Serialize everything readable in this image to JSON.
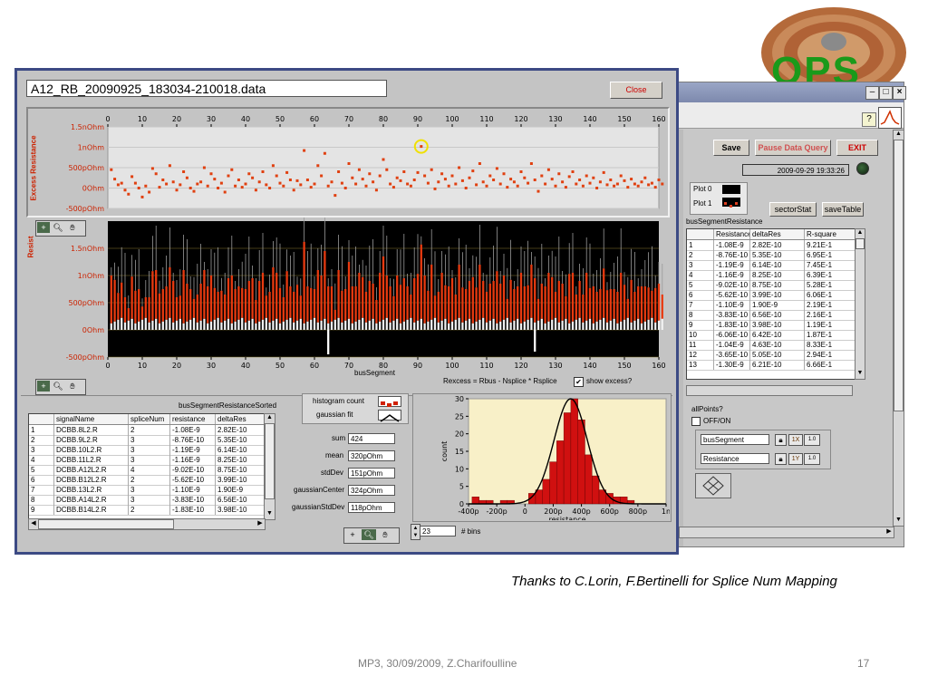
{
  "slide": {
    "caption": "Thanks to C.Lorin, F.Bertinelli for Splice Num Mapping",
    "footer": "MP3, 30/09/2009, Z.Charifoulline",
    "page_number": "17",
    "logo_text": "QPS"
  },
  "main_window": {
    "file_name": "A12_RB_20090925_183034-210018.data",
    "close_label": "Close",
    "top_chart": {
      "ylabel": "Excess Resistance",
      "y_ticks": [
        "1.5nOhm",
        "1nOhm",
        "500pOhm",
        "0Ohm",
        "-500pOhm"
      ],
      "x_ticks": [
        "0",
        "10",
        "20",
        "30",
        "40",
        "50",
        "60",
        "70",
        "80",
        "90",
        "100",
        "110",
        "120",
        "130",
        "140",
        "150",
        "160"
      ]
    },
    "bottom_chart": {
      "ylabel": "Resist",
      "y_ticks": [
        "1.5nOhm",
        "1nOhm",
        "500pOhm",
        "0Ohm",
        "-500pOhm"
      ],
      "x_ticks": [
        "0",
        "10",
        "20",
        "30",
        "40",
        "50",
        "60",
        "70",
        "80",
        "90",
        "100",
        "110",
        "120",
        "130",
        "140",
        "150",
        "160"
      ],
      "xlabel": "busSegment",
      "formula": "Rexcess = Rbus - Nsplice * Rsplice",
      "show_excess_label": "show excess?",
      "show_excess_checked": true
    },
    "table_title": "busSegmentResistanceSorted",
    "table": {
      "columns": [
        "signalName",
        "spliceNum",
        "resistance",
        "deltaRes"
      ],
      "rows": [
        [
          "1",
          "DCBB.8L2.R",
          "2",
          "-1.08E-9",
          "2.82E-10"
        ],
        [
          "2",
          "DCBB.9L2.R",
          "3",
          "-8.76E-10",
          "5.35E-10"
        ],
        [
          "3",
          "DCBB.10L2.R",
          "3",
          "-1.19E-9",
          "6.14E-10"
        ],
        [
          "4",
          "DCBB.11L2.R",
          "3",
          "-1.16E-9",
          "8.25E-10"
        ],
        [
          "5",
          "DCBB.A12L2.R",
          "4",
          "-9.02E-10",
          "8.75E-10"
        ],
        [
          "6",
          "DCBB.B12L2.R",
          "2",
          "-5.62E-10",
          "3.99E-10"
        ],
        [
          "7",
          "DCBB.13L2.R",
          "3",
          "-1.10E-9",
          "1.90E-9"
        ],
        [
          "8",
          "DCBB.A14L2.R",
          "3",
          "-3.83E-10",
          "6.56E-10"
        ],
        [
          "9",
          "DCBB.B14L2.R",
          "2",
          "-1.83E-10",
          "3.98E-10"
        ]
      ]
    },
    "stats": {
      "histogram_count_label": "histogram count",
      "gaussian_fit_label": "gaussian fit",
      "sum_label": "sum",
      "sum": "424",
      "mean_label": "mean",
      "mean": "320pOhm",
      "stddev_label": "stdDev",
      "stddev": "151pOhm",
      "gcenter_label": "gaussianCenter",
      "gcenter": "324pOhm",
      "gstddev_label": "gaussianStdDev",
      "gstddev": "118pOhm",
      "bins_value": "23",
      "bins_label": "# bins"
    },
    "histogram": {
      "ylabel": "count",
      "xlabel": "resistance",
      "y_ticks": [
        "30",
        "25",
        "20",
        "15",
        "10",
        "5",
        "0"
      ],
      "x_ticks": [
        "-400p",
        "-200p",
        "0",
        "200p",
        "400p",
        "600p",
        "800p",
        "1n"
      ]
    }
  },
  "right_window": {
    "save_label": "Save",
    "pause_label": "Pause Data Query",
    "exit_label": "EXIT",
    "timestamp": "2009-09-29 19:33:26",
    "plot0_label": "Plot 0",
    "plot1_label": "Plot 1",
    "sector_stat_label": "sectorStat",
    "save_table_label": "saveTable",
    "table_title": "busSegmentResistance",
    "table": {
      "columns": [
        "Resistance",
        "deltaRes",
        "R-square"
      ],
      "rows": [
        [
          "1",
          "-1.08E-9",
          "2.82E-10",
          "9.21E-1"
        ],
        [
          "2",
          "-8.76E-10",
          "5.35E-10",
          "6.95E-1"
        ],
        [
          "3",
          "-1.19E-9",
          "6.14E-10",
          "7.45E-1"
        ],
        [
          "4",
          "-1.16E-9",
          "8.25E-10",
          "6.39E-1"
        ],
        [
          "5",
          "-9.02E-10",
          "8.75E-10",
          "5.28E-1"
        ],
        [
          "6",
          "-5.62E-10",
          "3.99E-10",
          "6.06E-1"
        ],
        [
          "7",
          "-1.10E-9",
          "1.90E-9",
          "2.19E-1"
        ],
        [
          "8",
          "-3.83E-10",
          "6.56E-10",
          "2.16E-1"
        ],
        [
          "9",
          "-1.83E-10",
          "3.98E-10",
          "1.19E-1"
        ],
        [
          "10",
          "-6.06E-10",
          "6.42E-10",
          "1.87E-1"
        ],
        [
          "11",
          "-1.04E-9",
          "4.63E-10",
          "8.33E-1"
        ],
        [
          "12",
          "-3.65E-10",
          "5.05E-10",
          "2.94E-1"
        ],
        [
          "13",
          "-1.30E-9",
          "6.21E-10",
          "6.66E-1"
        ]
      ]
    },
    "all_points_label": "allPoints?",
    "off_on_label": "OFF/ON",
    "bus_segment_label": "busSegment",
    "resistance_label": "Resistance"
  },
  "chart_data": [
    {
      "type": "scatter",
      "ylabel": "Excess Resistance",
      "ylim": [
        -0.5,
        1.5
      ],
      "xlim": [
        0,
        160
      ],
      "y_unit": "nOhm",
      "series": [
        {
          "values": [
            0.45,
            0.22,
            0.08,
            0.12,
            -0.05,
            -0.15,
            0.28,
            0.12,
            0.0,
            -0.22,
            0.05,
            -0.1,
            0.48,
            0.35,
            0.02,
            0.2,
            0.1,
            0.55,
            0.15,
            -0.05,
            0.08,
            0.4,
            0.25,
            0.0,
            -0.08,
            0.1,
            0.15,
            0.5,
            0.05,
            0.35,
            0.22,
            0.0,
            0.12,
            -0.1,
            0.3,
            0.45,
            0.05,
            0.2,
            0.02,
            0.1,
            0.35,
            0.25,
            -0.05,
            0.15,
            0.4,
            0.08,
            0.0,
            0.55,
            0.3,
            0.12,
            0.05,
            0.38,
            0.2,
            -0.05,
            0.18,
            0.08,
            0.92,
            0.2,
            0.02,
            0.1,
            0.55,
            0.3,
            0.85,
            0.05,
            0.15,
            -0.18,
            0.4,
            0.12,
            0.0,
            0.6,
            0.25,
            0.1,
            0.45,
            0.22,
            0.05,
            0.35,
            0.15,
            -0.05,
            0.3,
            0.7,
            0.45,
            0.1,
            0.02,
            0.25,
            0.18,
            0.4,
            0.1,
            0.05,
            0.2,
            0.38,
            1.02,
            0.3,
            0.12,
            0.45,
            -0.02,
            0.15,
            0.35,
            0.22,
            0.05,
            0.3,
            0.1,
            0.5,
            0.18,
            0.0,
            0.25,
            0.42,
            0.08,
            0.6,
            0.15,
            0.05,
            0.3,
            0.2,
            0.48,
            0.1,
            0.35,
            0.02,
            0.22,
            0.15,
            0.05,
            0.4,
            0.25,
            0.12,
            0.6,
            0.2,
            -0.08,
            0.3,
            0.1,
            0.45,
            0.22,
            0.05,
            0.35,
            0.15,
            0.02,
            0.28,
            0.4,
            0.1,
            0.2,
            0.05,
            0.3,
            0.12,
            0.25,
            0.0,
            0.15,
            0.38,
            0.08,
            0.2,
            0.05,
            0.1,
            0.3,
            0.18,
            0.02,
            0.22,
            0.1,
            0.05,
            0.15,
            0.25,
            0.08,
            0.12,
            0.02,
            0.2,
            0.1
          ]
        }
      ]
    },
    {
      "type": "bar",
      "ylabel": "count",
      "xlabel": "resistance",
      "x_unit": "pOhm",
      "bin_centers": [
        -350,
        -300,
        -250,
        -200,
        -150,
        -100,
        -50,
        0,
        50,
        100,
        150,
        200,
        250,
        300,
        350,
        400,
        450,
        500,
        550,
        600,
        650,
        700,
        750
      ],
      "values": [
        2,
        1,
        1,
        0,
        1,
        1,
        0,
        0,
        3,
        4,
        7,
        12,
        18,
        26,
        30,
        24,
        14,
        8,
        4,
        3,
        2,
        2,
        1
      ],
      "ylim": [
        0,
        30
      ],
      "xlim": [
        -400,
        1000
      ]
    }
  ]
}
